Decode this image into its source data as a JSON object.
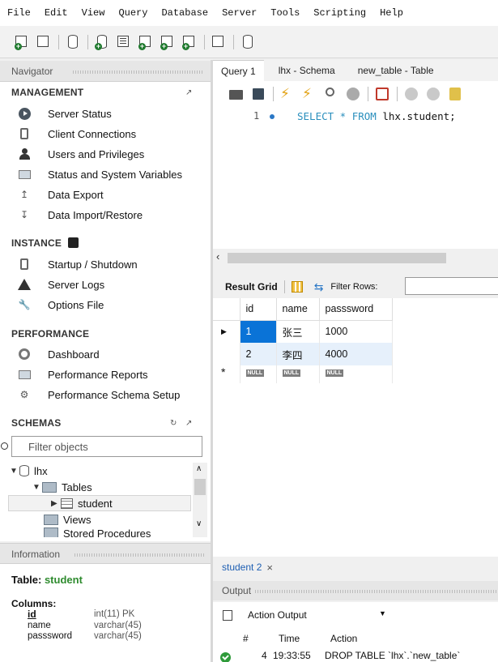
{
  "menu": [
    "File",
    "Edit",
    "View",
    "Query",
    "Database",
    "Server",
    "Tools",
    "Scripting",
    "Help"
  ],
  "navigator": {
    "title": "Navigator",
    "management": {
      "title": "MANAGEMENT",
      "items": [
        "Server Status",
        "Client Connections",
        "Users and Privileges",
        "Status and System Variables",
        "Data Export",
        "Data Import/Restore"
      ]
    },
    "instance": {
      "title": "INSTANCE",
      "items": [
        "Startup / Shutdown",
        "Server Logs",
        "Options File"
      ]
    },
    "performance": {
      "title": "PERFORMANCE",
      "items": [
        "Dashboard",
        "Performance Reports",
        "Performance Schema Setup"
      ]
    },
    "schemas": {
      "title": "SCHEMAS",
      "filter_placeholder": "Filter objects",
      "tree": {
        "db": "lhx",
        "tables_label": "Tables",
        "table": "student",
        "views_label": "Views",
        "procs_label": "Stored Procedures"
      }
    }
  },
  "information": {
    "title": "Information",
    "table_label": "Table:",
    "table_name": "student",
    "columns_label": "Columns:",
    "columns": [
      {
        "name": "id",
        "type": "int(11) PK"
      },
      {
        "name": "name",
        "type": "varchar(45)"
      },
      {
        "name": "passsword",
        "type": "varchar(45)"
      }
    ]
  },
  "tabs": [
    "Query 1",
    "lhx - Schema",
    "new_table - Table"
  ],
  "editor": {
    "line_number": "1",
    "sql_keyword1": "SELECT * FROM",
    "sql_rest": " lhx.student;"
  },
  "result": {
    "grid_label": "Result Grid",
    "filter_label": "Filter Rows:",
    "columns": [
      "id",
      "name",
      "passsword"
    ],
    "rows": [
      [
        "1",
        "张三",
        "1000"
      ],
      [
        "2",
        "李四",
        "4000"
      ]
    ],
    "null_label": "NULL"
  },
  "result_tab": "student 2",
  "output": {
    "title": "Output",
    "selector": "Action Output",
    "headers": {
      "num": "#",
      "time": "Time",
      "action": "Action"
    },
    "row": {
      "num": "4",
      "time": "19:33:55",
      "action": "DROP TABLE `lhx`.`new_table`"
    }
  },
  "colors": {
    "selection": "#0a73d7",
    "keyword": "#2a8fbd",
    "ok": "#2e9a3a"
  }
}
